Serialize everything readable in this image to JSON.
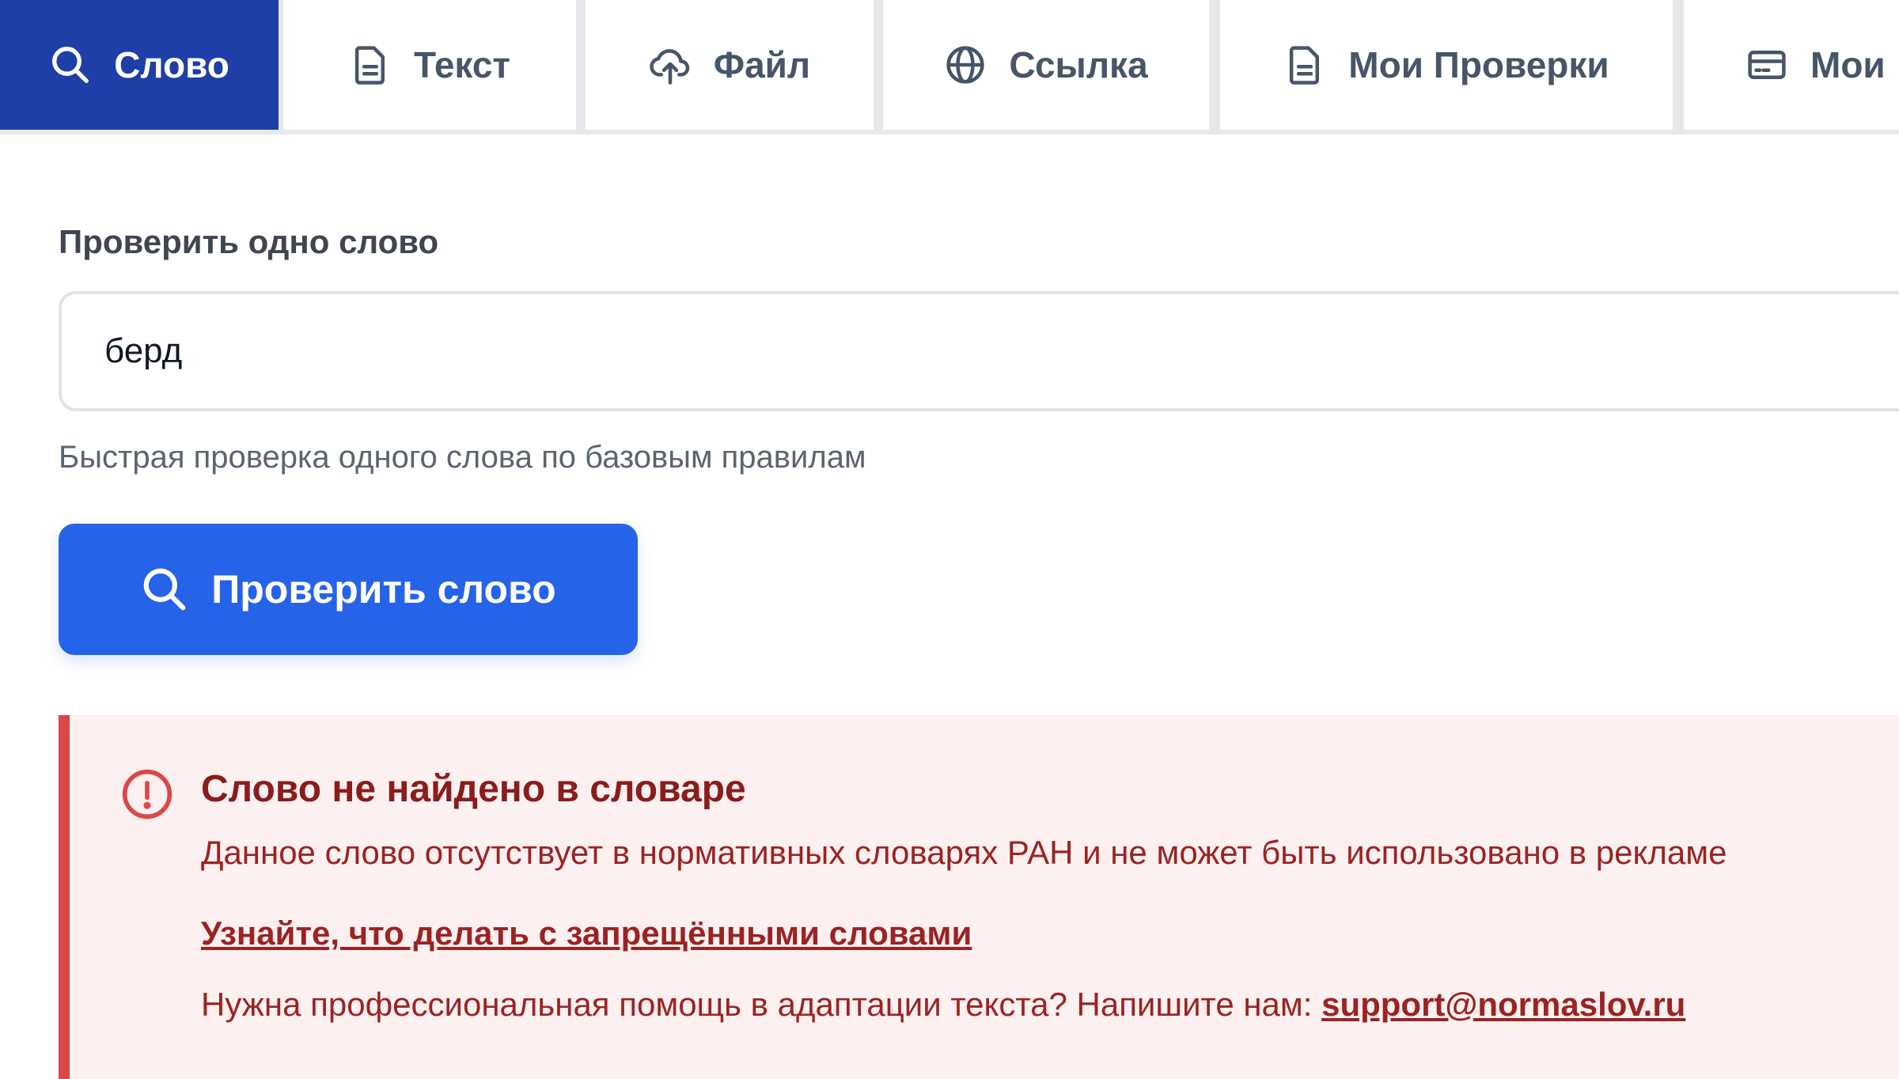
{
  "tabs": [
    {
      "label": "Слово",
      "icon": "search-icon",
      "active": true
    },
    {
      "label": "Текст",
      "icon": "document-icon",
      "active": false
    },
    {
      "label": "Файл",
      "icon": "cloud-upload-icon",
      "active": false
    },
    {
      "label": "Ссылка",
      "icon": "globe-icon",
      "active": false
    },
    {
      "label": "Мои Проверки",
      "icon": "document-icon",
      "active": false
    },
    {
      "label": "Мои",
      "icon": "card-icon",
      "active": false
    }
  ],
  "form": {
    "title": "Проверить одно слово",
    "input_value": "берд",
    "hint": "Быстрая проверка одного слова по базовым правилам",
    "button_label": "Проверить слово"
  },
  "alert": {
    "title": "Слово не найдено в словаре",
    "description": "Данное слово отсутствует в нормативных словарях РАН и не может быть использовано в рекламе",
    "link_text": "Узнайте, что делать с запрещёнными словами",
    "help_text": "Нужна профессиональная помощь в адаптации текста? Напишите нам: ",
    "email": "support@normaslov.ru"
  },
  "colors": {
    "active_tab": "#1e3fa8",
    "primary_button": "#2563e8",
    "alert_bg": "#fdf0f0",
    "alert_border": "#dc4747",
    "alert_text": "#9b2323"
  }
}
